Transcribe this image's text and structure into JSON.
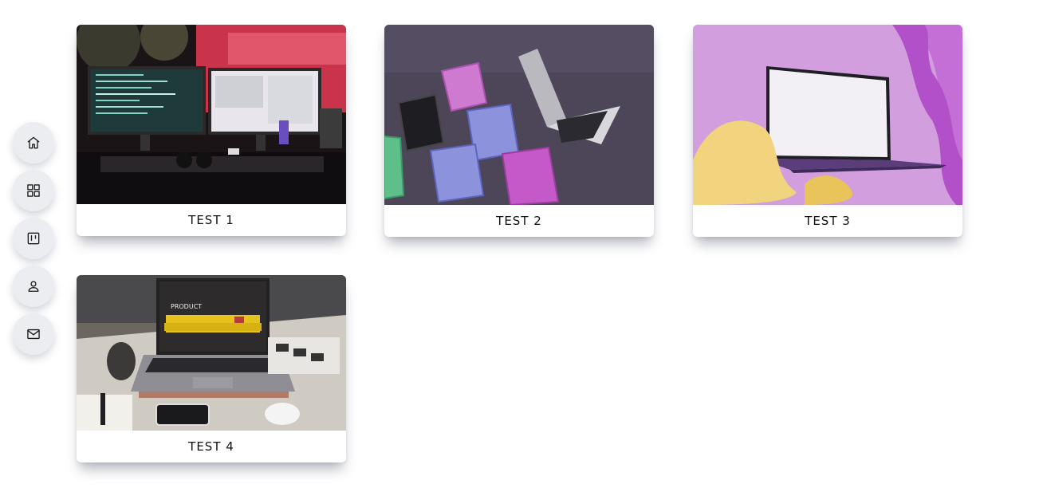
{
  "sidebar": {
    "items": [
      {
        "id": "home",
        "icon": "home-icon"
      },
      {
        "id": "apps",
        "icon": "grid-icon"
      },
      {
        "id": "board",
        "icon": "kanban-icon"
      },
      {
        "id": "profile",
        "icon": "user-icon"
      },
      {
        "id": "contact",
        "icon": "mail-icon"
      }
    ]
  },
  "cards": [
    {
      "title": "TEST 1",
      "image": "desk-monitors-image"
    },
    {
      "title": "TEST 2",
      "image": "shopping-baskets-laptop-image"
    },
    {
      "title": "TEST 3",
      "image": "floating-laptop-image"
    },
    {
      "title": "TEST 4",
      "image": "laptop-product-page-image"
    }
  ],
  "colors": {
    "nav_bg": "#ecedf1",
    "card_text": "#111111",
    "page_bg": "#ffffff"
  }
}
